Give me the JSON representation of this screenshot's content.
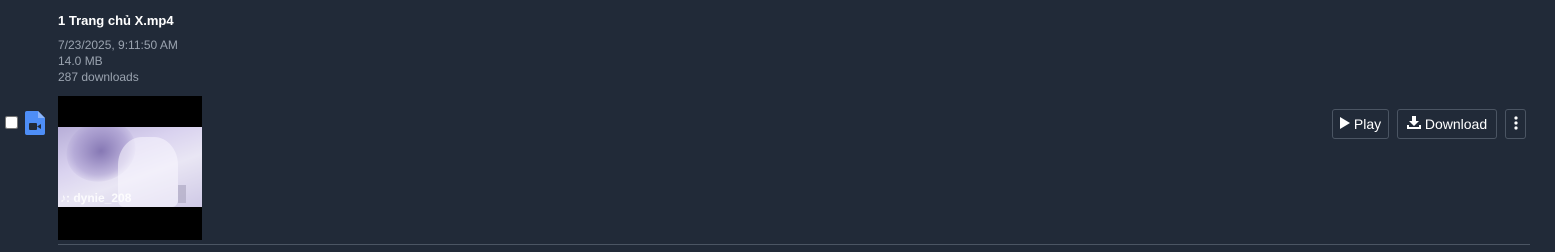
{
  "file": {
    "name": "1 Trang chủ X.mp4",
    "date": "7/23/2025, 9:11:50 AM",
    "size": "14.0 MB",
    "downloads": "287 downloads",
    "thumbnail_watermark": "♪: dynie_208"
  },
  "actions": {
    "play_label": "Play",
    "download_label": "Download"
  },
  "icons": {
    "file_type": "file-video-icon",
    "play": "play-icon",
    "download": "download-icon",
    "more": "more-vertical-icon"
  },
  "colors": {
    "background": "#212a38",
    "file_icon": "#4e8ef7",
    "button_border": "#4b5563",
    "meta_text": "#9aa3af"
  }
}
